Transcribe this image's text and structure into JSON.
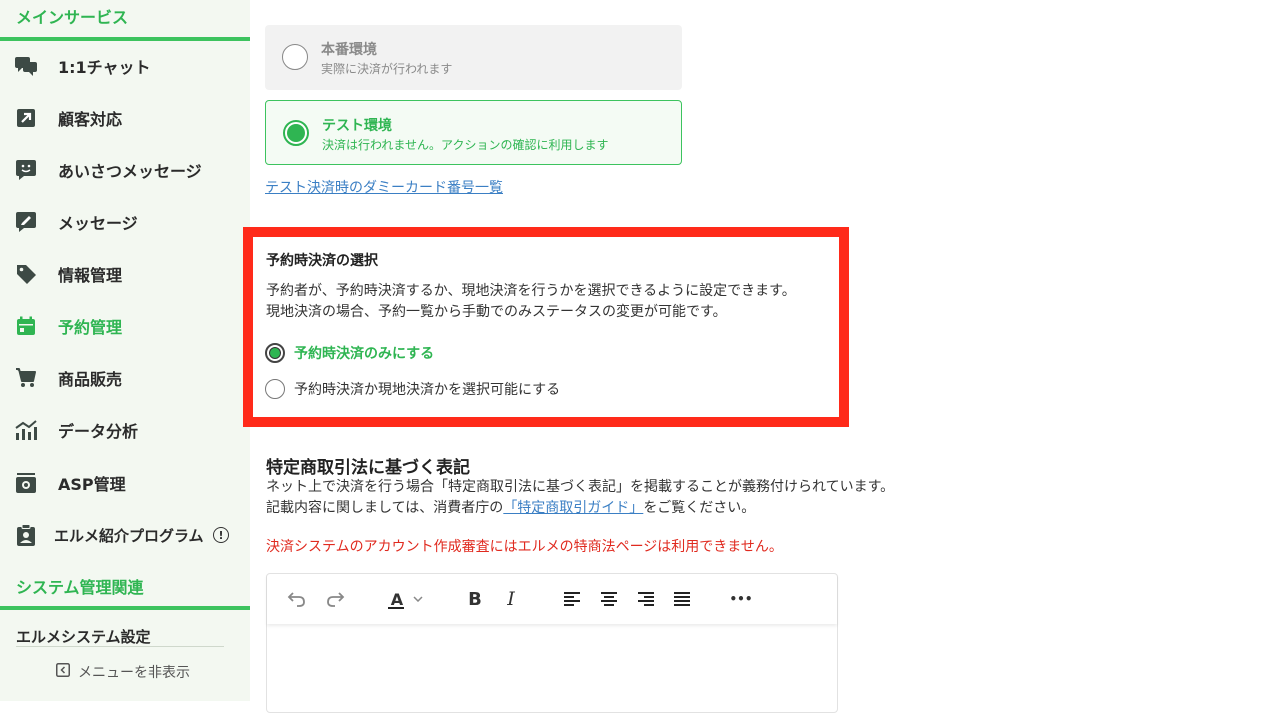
{
  "sidebar": {
    "main_section": "メインサービス",
    "items": [
      {
        "label": "1:1チャット",
        "icon": "chat-bubbles-icon"
      },
      {
        "label": "顧客対応",
        "icon": "arrow-up-right-icon"
      },
      {
        "label": "あいさつメッセージ",
        "icon": "smile-message-icon"
      },
      {
        "label": "メッセージ",
        "icon": "edit-message-icon"
      },
      {
        "label": "情報管理",
        "icon": "tag-icon"
      },
      {
        "label": "予約管理",
        "icon": "calendar-icon"
      },
      {
        "label": "商品販売",
        "icon": "cart-icon"
      },
      {
        "label": "データ分析",
        "icon": "chart-icon"
      },
      {
        "label": "ASP管理",
        "icon": "inbox-icon"
      },
      {
        "label": "エルメ紹介プログラム",
        "icon": "clipboard-user-icon"
      }
    ],
    "active_item": "予約管理",
    "system_section": "システム管理関連",
    "settings": "エルメシステム設定",
    "hide_menu": "メニューを非表示",
    "info_badge": "!"
  },
  "env": {
    "prod_title": "本番環境",
    "prod_desc": "実際に決済が行われます",
    "test_title": "テスト環境",
    "test_desc": "決済は行われません。アクションの確認に利用します",
    "selected": "テスト環境",
    "dummy_link": "テスト決済時のダミーカード番号一覧"
  },
  "reservation_payment": {
    "title": "予約時決済の選択",
    "desc_line1": "予約者が、予約時決済するか、現地決済を行うかを選択できるように設定できます。",
    "desc_line2": "現地決済の場合、予約一覧から手動でのみステータスの変更が可能です。",
    "option1": "予約時決済のみにする",
    "option2": "予約時決済か現地決済かを選択可能にする",
    "selected": "予約時決済のみにする"
  },
  "law": {
    "title": "特定商取引法に基づく表記",
    "desc_line1": "ネット上で決済を行う場合「特定商取引法に基づく表記」を掲載することが義務付けられています。",
    "desc_line2_pre": "記載内容に関しましては、消費者庁の",
    "desc_link": "「特定商取引ガイド」",
    "desc_line2_post": "をご覧ください。",
    "warning": "決済システムのアカウント作成審査にはエルメの特商法ページは利用できません。"
  },
  "editor": {
    "toolbar": [
      "undo-icon",
      "redo-icon",
      "text-color-icon",
      "bold-icon",
      "italic-icon",
      "align-left-icon",
      "align-center-icon",
      "align-right-icon",
      "align-justify-icon",
      "more-icon"
    ],
    "text_color_glyph": "A",
    "bold_glyph": "B",
    "italic_glyph": "I",
    "more_glyph": "•••",
    "accent": "#2fb552"
  }
}
